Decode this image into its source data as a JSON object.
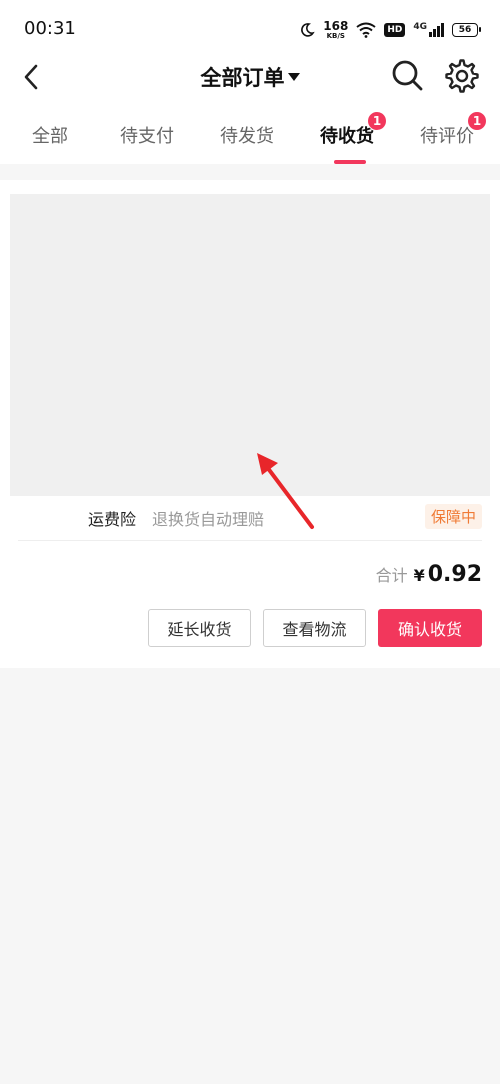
{
  "status_bar": {
    "time": "00:31",
    "net_speed": "168",
    "net_unit": "KB/S",
    "hd_label": "HD",
    "network_type": "4G",
    "battery": "56"
  },
  "nav": {
    "title": "全部订单"
  },
  "tabs": [
    {
      "label": "全部"
    },
    {
      "label": "待支付"
    },
    {
      "label": "待发货"
    },
    {
      "label": "待收货",
      "badge": "1"
    },
    {
      "label": "待评价",
      "badge": "1"
    }
  ],
  "order": {
    "insurance_label": "运费险",
    "insurance_desc": "退换货自动理赔",
    "insurance_status": "保障中",
    "total_label": "合计",
    "currency": "¥",
    "total_amount": "0.92",
    "buttons": {
      "extend": "延长收货",
      "logistics": "查看物流",
      "confirm": "确认收货"
    }
  },
  "colors": {
    "accent": "#f2375c",
    "insurance_status": "#f07a35"
  }
}
